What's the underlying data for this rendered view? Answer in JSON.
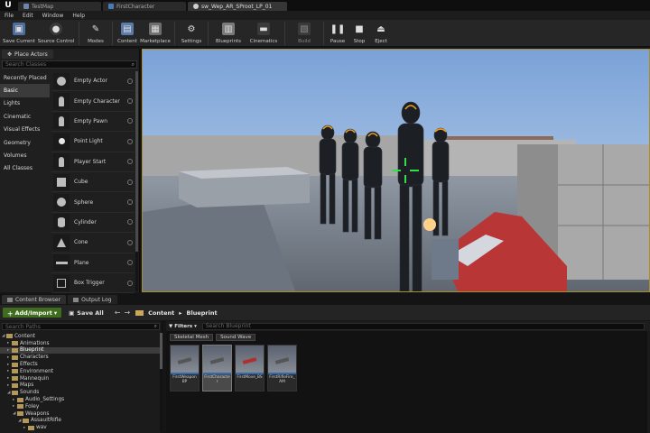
{
  "title_bar": {
    "tabs": [
      {
        "label": "TestMap",
        "icon": "map-icon",
        "active": false
      },
      {
        "label": "FirstCharacter",
        "icon": "blueprint-icon",
        "active": false
      },
      {
        "label": "sw_Wep_AR_SProot_LP_01",
        "icon": "animation-icon",
        "active": true
      }
    ]
  },
  "menu": [
    "File",
    "Edit",
    "Window",
    "Help"
  ],
  "toolbar": {
    "save_current": "Save Current",
    "source_control": "Source Control",
    "modes": "Modes",
    "content": "Content",
    "marketplace": "Marketplace",
    "settings": "Settings",
    "blueprints": "Blueprints",
    "cinematics": "Cinematics",
    "build": "Build",
    "pause": "Pause",
    "stop": "Stop",
    "eject": "Eject"
  },
  "place_actors": {
    "tab_label": "Place Actors",
    "search_placeholder": "Search Classes",
    "categories": [
      "Recently Placed",
      "Basic",
      "Lights",
      "Cinematic",
      "Visual Effects",
      "Geometry",
      "Volumes",
      "All Classes"
    ],
    "active_category": "Basic",
    "items": [
      {
        "label": "Empty Actor",
        "icon": "sphere"
      },
      {
        "label": "Empty Character",
        "icon": "person"
      },
      {
        "label": "Empty Pawn",
        "icon": "person"
      },
      {
        "label": "Point Light",
        "icon": "bulb"
      },
      {
        "label": "Player Start",
        "icon": "person"
      },
      {
        "label": "Cube",
        "icon": "cube"
      },
      {
        "label": "Sphere",
        "icon": "sphere"
      },
      {
        "label": "Cylinder",
        "icon": "cyl"
      },
      {
        "label": "Cone",
        "icon": "cone"
      },
      {
        "label": "Plane",
        "icon": "plane"
      },
      {
        "label": "Box Trigger",
        "icon": "cube"
      }
    ]
  },
  "bottom_tabs": {
    "content_browser": "Content Browser",
    "output_log": "Output Log"
  },
  "content_browser": {
    "add_import": "Add/Import",
    "save_all": "Save All",
    "breadcrumb": [
      "Content",
      "Blueprint"
    ],
    "search_paths_placeholder": "Search Paths",
    "filters_label": "Filters",
    "search_placeholder": "Search Blueprint",
    "filter_chips": [
      "Skeletal Mesh",
      "Sound Wave"
    ],
    "tree": [
      {
        "label": "Content",
        "depth": 0,
        "expanded": true,
        "selected": false
      },
      {
        "label": "Animations",
        "depth": 1,
        "expanded": false,
        "selected": false
      },
      {
        "label": "Blueprint",
        "depth": 1,
        "expanded": false,
        "selected": true
      },
      {
        "label": "Characters",
        "depth": 1,
        "expanded": false,
        "selected": false
      },
      {
        "label": "Effects",
        "depth": 1,
        "expanded": false,
        "selected": false
      },
      {
        "label": "Environment",
        "depth": 1,
        "expanded": false,
        "selected": false
      },
      {
        "label": "Mannequin",
        "depth": 1,
        "expanded": false,
        "selected": false
      },
      {
        "label": "Maps",
        "depth": 1,
        "expanded": false,
        "selected": false
      },
      {
        "label": "Sounds",
        "depth": 1,
        "expanded": true,
        "selected": false
      },
      {
        "label": "Audio_Settings",
        "depth": 2,
        "expanded": false,
        "selected": false
      },
      {
        "label": "Foley",
        "depth": 2,
        "expanded": false,
        "selected": false
      },
      {
        "label": "Weapons",
        "depth": 2,
        "expanded": true,
        "selected": false
      },
      {
        "label": "AssaultRifle",
        "depth": 3,
        "expanded": true,
        "selected": false
      },
      {
        "label": "wav",
        "depth": 4,
        "expanded": false,
        "selected": false
      }
    ],
    "assets": [
      {
        "name": "FirstWeaponBP",
        "selected": false
      },
      {
        "name": "FirstCharacter",
        "selected": true
      },
      {
        "name": "FirstMove_BS",
        "selected": false
      },
      {
        "name": "FirstRifleFire_AM",
        "selected": false
      }
    ]
  },
  "colors": {
    "accent_add": "#3f6c1d",
    "viewport_border": "#a78c30",
    "crosshair": "#33e04a"
  }
}
